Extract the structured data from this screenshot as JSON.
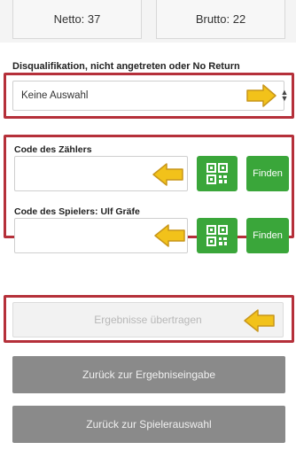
{
  "scores": {
    "netto": "Netto: 37",
    "brutto": "Brutto: 22"
  },
  "disqualification": {
    "label": "Disqualifikation, nicht angetreten oder No Return",
    "selected": "Keine Auswahl"
  },
  "marker_color": "#b5303a",
  "arrow_color": "#f2c21a",
  "counter_code": {
    "label": "Code des Zählers",
    "find_label": "Finden"
  },
  "player_code": {
    "label": "Code des Spielers: Ulf Gräfe",
    "find_label": "Finden"
  },
  "icons": {
    "qr": "qr-code-icon",
    "select": "sort-updown-icon",
    "arrow": "arrow-left-icon"
  },
  "actions": {
    "submit": "Ergebnisse übertragen",
    "back_results": "Zurück zur Ergebniseingabe",
    "back_players": "Zurück zur Spielerauswahl"
  }
}
